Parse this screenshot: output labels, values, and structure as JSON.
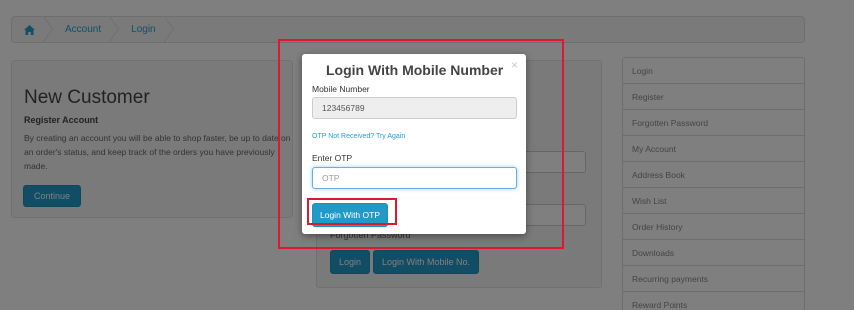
{
  "breadcrumb": {
    "home_icon": "home-icon",
    "items": [
      "Account",
      "Login"
    ]
  },
  "new_customer": {
    "title": "New Customer",
    "subtitle": "Register Account",
    "description": "By creating an account you will be able to shop faster, be up to date on an order's status, and keep track of the orders you have previously made.",
    "continue_label": "Continue"
  },
  "returning": {
    "forgotten_label": "Forgotten Password",
    "login_label": "Login",
    "login_mobile_label": "Login With Mobile No."
  },
  "sidebar": {
    "items": [
      {
        "label": "Login"
      },
      {
        "label": "Register"
      },
      {
        "label": "Forgotten Password"
      },
      {
        "label": "My Account"
      },
      {
        "label": "Address Book"
      },
      {
        "label": "Wish List"
      },
      {
        "label": "Order History"
      },
      {
        "label": "Downloads"
      },
      {
        "label": "Recurring payments"
      },
      {
        "label": "Reward Points"
      }
    ]
  },
  "modal": {
    "title": "Login With Mobile Number",
    "close_symbol": "×",
    "mobile_label": "Mobile Number",
    "mobile_value": "123456789",
    "resend_link": "OTP Not Received? Try Again",
    "otp_label": "Enter OTP",
    "otp_placeholder": "OTP",
    "submit_label": "Login With OTP"
  },
  "colors": {
    "primary": "#229ac8",
    "link": "#23a1d1",
    "highlight": "#e0182d"
  }
}
